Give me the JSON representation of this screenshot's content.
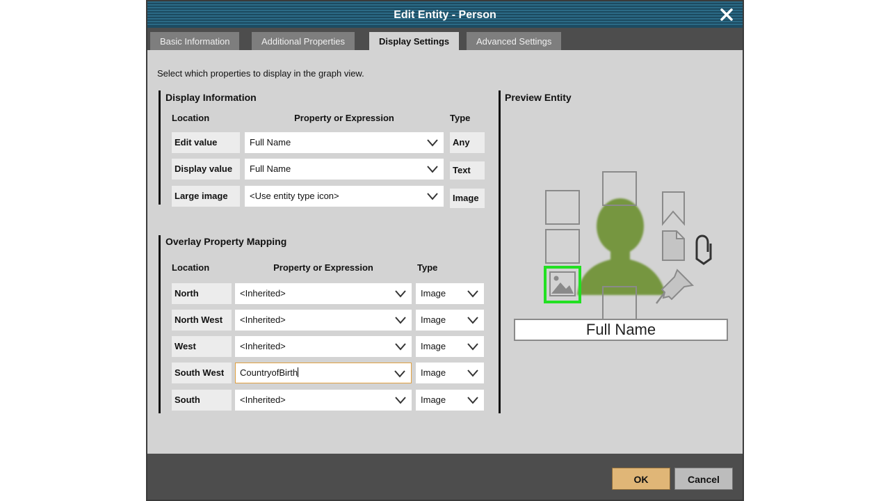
{
  "dialog": {
    "title": "Edit Entity - Person"
  },
  "tabs": [
    {
      "label": "Basic Information",
      "active": false
    },
    {
      "label": "Additional Properties",
      "active": false
    },
    {
      "label": "Display Settings",
      "active": true
    },
    {
      "label": "Advanced Settings",
      "active": false
    }
  ],
  "instructions": "Select which properties to display in the graph view.",
  "display_info": {
    "title": "Display Information",
    "headers": {
      "location": "Location",
      "property": "Property or Expression",
      "type": "Type"
    },
    "rows": [
      {
        "label": "Edit value",
        "value": "Full Name",
        "type": "Any"
      },
      {
        "label": "Display value",
        "value": "Full Name",
        "type": "Text"
      },
      {
        "label": "Large image",
        "value": "<Use entity type icon>",
        "type": "Image"
      }
    ]
  },
  "overlay": {
    "title": "Overlay Property Mapping",
    "headers": {
      "location": "Location",
      "property": "Property or Expression",
      "type": "Type"
    },
    "rows": [
      {
        "label": "North",
        "value": "<Inherited>",
        "type": "Image"
      },
      {
        "label": "North West",
        "value": "<Inherited>",
        "type": "Image"
      },
      {
        "label": "West",
        "value": "<Inherited>",
        "type": "Image"
      },
      {
        "label": "South West",
        "value": "CountryofBirth",
        "type": "Image"
      },
      {
        "label": "South",
        "value": "<Inherited>",
        "type": "Image"
      }
    ]
  },
  "preview": {
    "title": "Preview Entity",
    "name": "Full Name",
    "person_color": "#76963f",
    "highlight_color": "#22e022"
  },
  "buttons": {
    "ok": "OK",
    "cancel": "Cancel"
  },
  "colors": {
    "title_bar": "#2b6a86",
    "ok_button": "#e0b677",
    "panel": "#d3d3d3"
  }
}
